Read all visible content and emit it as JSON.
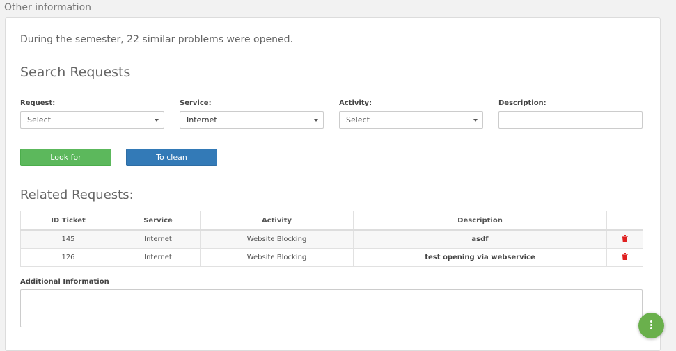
{
  "section": {
    "title": "Other information"
  },
  "intro": {
    "text": "During the semester, 22 similar problems were opened."
  },
  "search": {
    "heading": "Search Requests",
    "fields": {
      "request": {
        "label": "Request:",
        "value": "Select"
      },
      "service": {
        "label": "Service:",
        "value": "Internet"
      },
      "activity": {
        "label": "Activity:",
        "value": "Select"
      },
      "description": {
        "label": "Description:",
        "value": ""
      }
    },
    "buttons": {
      "look_for": "Look for",
      "clean": "To clean"
    }
  },
  "related": {
    "heading": "Related Requests:",
    "columns": [
      "ID Ticket",
      "Service",
      "Activity",
      "Description",
      ""
    ],
    "rows": [
      {
        "id": "145",
        "service": "Internet",
        "activity": "Website Blocking",
        "description": "asdf",
        "action_icon": "trash-icon"
      },
      {
        "id": "126",
        "service": "Internet",
        "activity": "Website Blocking",
        "description": "test opening via webservice",
        "action_icon": "trash-icon"
      }
    ]
  },
  "additional": {
    "label": "Additional Information",
    "value": ""
  },
  "fab": {
    "icon": "more-vertical-icon"
  },
  "colors": {
    "green": "#5cb85c",
    "blue": "#337ab7",
    "trash": "#e02020",
    "fab": "#6ab04c"
  }
}
